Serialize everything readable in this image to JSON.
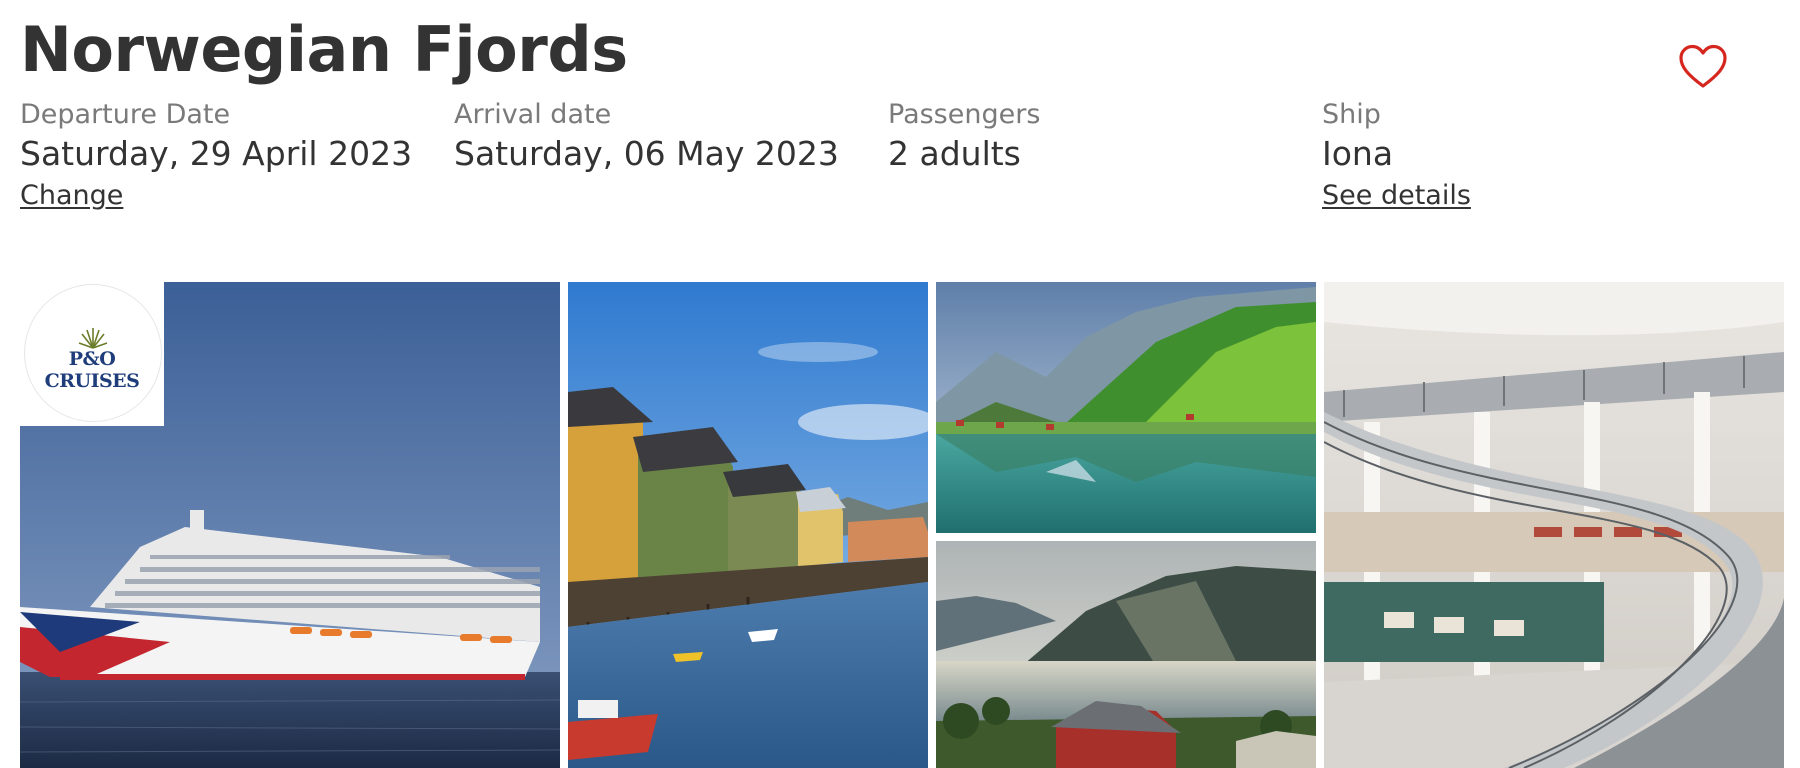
{
  "header": {
    "title": "Norwegian Fjords",
    "favourite_icon": "heart-icon",
    "accent_color": "#d6271f"
  },
  "details": {
    "departure": {
      "label": "Departure Date",
      "value": "Saturday, 29 April 2023",
      "link": "Change"
    },
    "arrival": {
      "label": "Arrival date",
      "value": "Saturday, 06 May 2023"
    },
    "passengers": {
      "label": "Passengers",
      "value": "2 adults"
    },
    "ship": {
      "label": "Ship",
      "value": "Iona",
      "link": "See details"
    }
  },
  "gallery": {
    "logo_text": "P&O CRUISES",
    "images": [
      {
        "subject": "cruise-ship-iona"
      },
      {
        "subject": "harbour-warehouses"
      },
      {
        "subject": "fjord-valley"
      },
      {
        "subject": "fjord-sunlight"
      },
      {
        "subject": "ship-atrium-interior"
      }
    ]
  }
}
